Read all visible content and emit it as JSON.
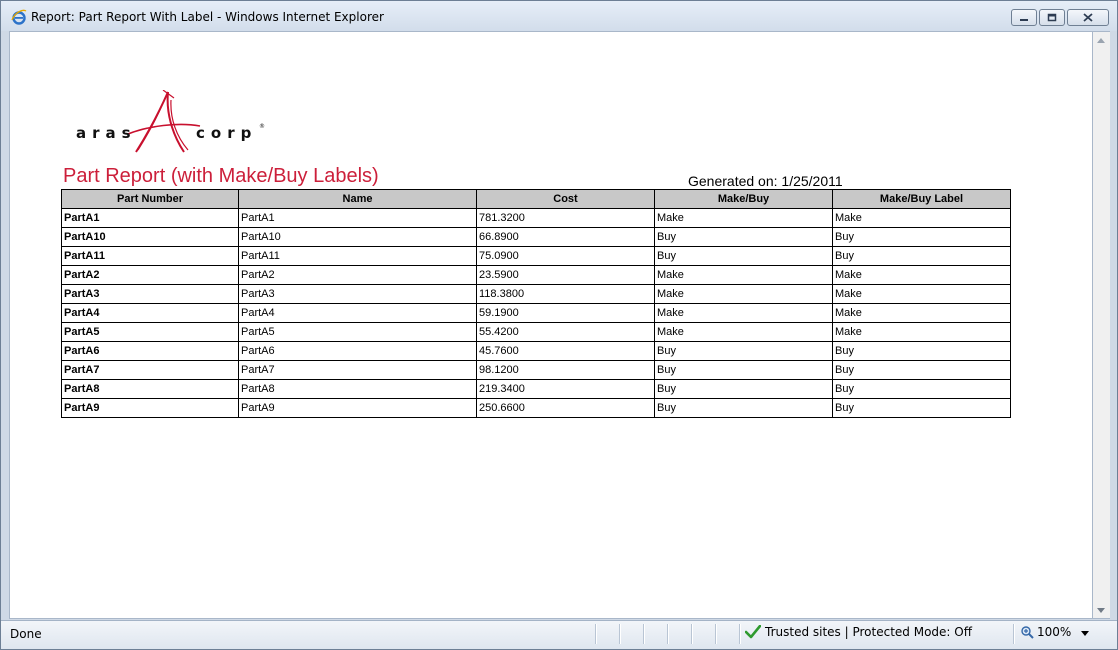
{
  "window": {
    "title": "Report: Part Report With Label - Windows Internet Explorer"
  },
  "report": {
    "logo_text_left": "aras",
    "logo_text_right": "corp",
    "title": "Part Report (with Make/Buy Labels)",
    "generated_label": "Generated on:",
    "generated_date": "1/25/2011",
    "columns": [
      "Part Number",
      "Name",
      "Cost",
      "Make/Buy",
      "Make/Buy Label"
    ],
    "rows": [
      [
        "PartA1",
        "PartA1",
        "781.3200",
        "Make",
        "Make"
      ],
      [
        "PartA10",
        "PartA10",
        "66.8900",
        "Buy",
        "Buy"
      ],
      [
        "PartA11",
        "PartA11",
        "75.0900",
        "Buy",
        "Buy"
      ],
      [
        "PartA2",
        "PartA2",
        "23.5900",
        "Make",
        "Make"
      ],
      [
        "PartA3",
        "PartA3",
        "118.3800",
        "Make",
        "Make"
      ],
      [
        "PartA4",
        "PartA4",
        "59.1900",
        "Make",
        "Make"
      ],
      [
        "PartA5",
        "PartA5",
        "55.4200",
        "Make",
        "Make"
      ],
      [
        "PartA6",
        "PartA6",
        "45.7600",
        "Buy",
        "Buy"
      ],
      [
        "PartA7",
        "PartA7",
        "98.1200",
        "Buy",
        "Buy"
      ],
      [
        "PartA8",
        "PartA8",
        "219.3400",
        "Buy",
        "Buy"
      ],
      [
        "PartA9",
        "PartA9",
        "250.6600",
        "Buy",
        "Buy"
      ]
    ]
  },
  "statusbar": {
    "status_text": "Done",
    "zone_text": "Trusted sites | Protected Mode: Off",
    "zoom_text": "100%"
  },
  "colors": {
    "title_red": "#cc1f3a",
    "header_gray": "#c8c8c8",
    "check_green": "#2e9a2e"
  }
}
